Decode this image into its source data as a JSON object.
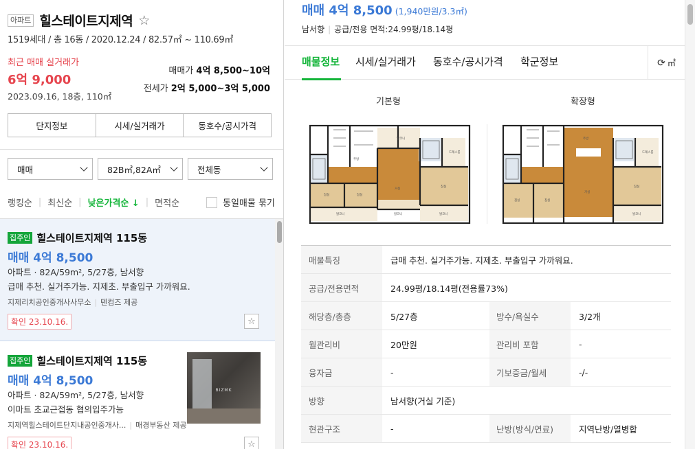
{
  "complex": {
    "type_tag": "아파트",
    "name": "힐스테이트지제역",
    "info": "1519세대 / 총 16동 / 2020.12.24 / 82.57㎡ ~ 110.69㎡",
    "recent_label": "최근 매매 실거래가",
    "recent_price": "6억 9,000",
    "recent_date": "2023.09.16, 18층, 110㎡",
    "sale_label": "매매가",
    "sale_range": "4억 8,500~10억",
    "jeonse_label": "전세가",
    "jeonse_range": "2억 5,000~3억 5,000"
  },
  "tabs": [
    "단지정보",
    "시세/실거래가",
    "동호수/공시가격"
  ],
  "filters": {
    "trade": "매매",
    "area": "82B㎡,82A㎡",
    "dong": "전체동"
  },
  "sorts": [
    "랭킹순",
    "최신순",
    "낮은가격순 ↓",
    "면적순"
  ],
  "group_label": "동일매물 묶기",
  "listings": [
    {
      "badge": "집주인",
      "name": "힐스테이트지제역 115동",
      "price": "매매 4억 8,500",
      "desc": "아파트 · 82A/59m², 5/27층, 남서향",
      "feature": "급매 추천. 실거주가능. 지제초. 부출입구 가까워요.",
      "agent": "지제리치공인중개사사무소",
      "provider": "텐컴즈 제공",
      "confirm": "확인 23.10.16."
    },
    {
      "badge": "집주인",
      "name": "힐스테이트지제역 115동",
      "price": "매매 4억 8,500",
      "desc": "아파트 · 82A/59m², 5/27층, 남서향",
      "feature": "이마트 초교근접동 협의입주가능",
      "agent": "지제역힐스테이트단지내공인중개사...",
      "provider": "매경부동산 제공",
      "confirm": "확인 23.10.16.",
      "thumb_watermark": "BIZMK"
    }
  ],
  "detail": {
    "price": "매매 4억 8,500",
    "price_per": "(1,940만원/3.3㎡)",
    "direction": "남서향",
    "area": "공급/전용 면적:24.99평/18.14평",
    "tabs": [
      "매물정보",
      "시세/실거래가",
      "동호수/공시가격",
      "학군정보"
    ],
    "unit_toggle": "㎡",
    "plans": [
      "기본형",
      "확장형"
    ],
    "table": [
      {
        "k": "매물특징",
        "v": "급매 추천. 실거주가능. 지제초. 부출입구 가까워요."
      },
      {
        "k": "공급/전용면적",
        "v": "24.99평/18.14평(전용률73%)"
      },
      {
        "k": "해당층/총층",
        "v": "5/27층",
        "k2": "방수/욕실수",
        "v2": "3/2개"
      },
      {
        "k": "월관리비",
        "v": "20만원",
        "k2": "관리비 포함",
        "v2": "-"
      },
      {
        "k": "융자금",
        "v": "-",
        "k2": "기보증금/월세",
        "v2": "-/-"
      },
      {
        "k": "방향",
        "v": "남서향(거실 기준)"
      },
      {
        "k": "현관구조",
        "v": "-",
        "k2": "난방(방식/연료)",
        "v2": "지역난방/열병합"
      }
    ]
  }
}
